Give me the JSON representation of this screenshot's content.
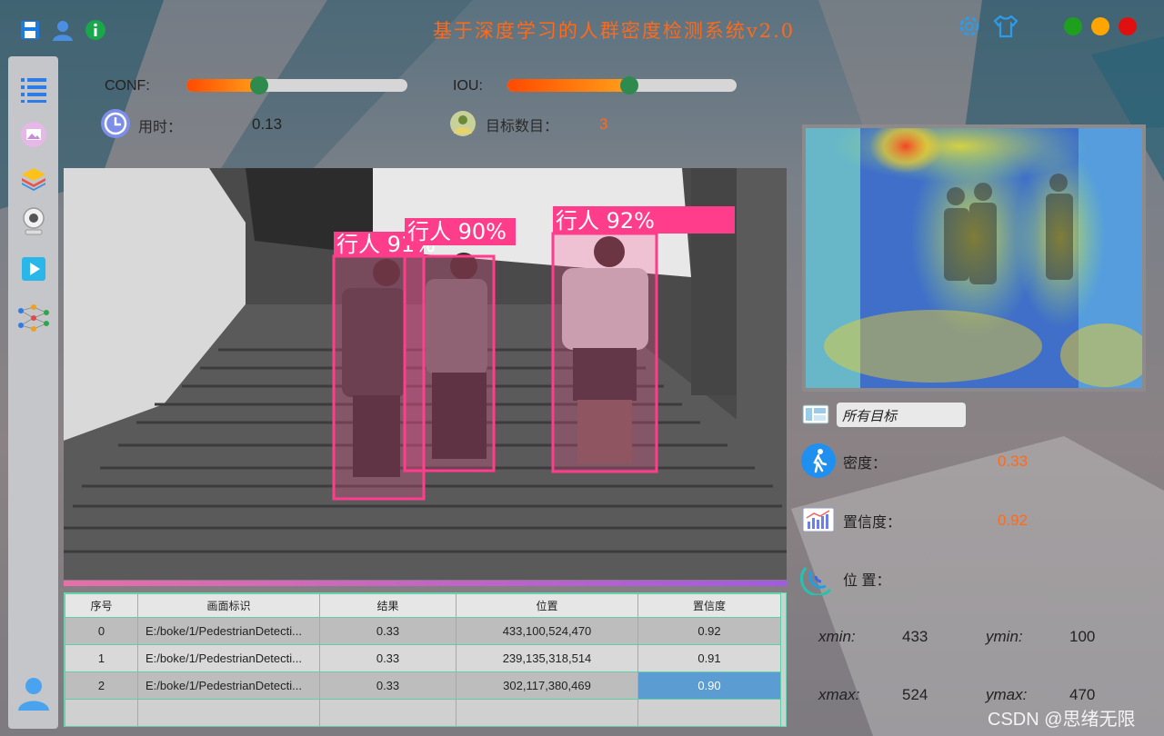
{
  "app": {
    "title": "基于深度学习的人群密度检测系统v2.0",
    "accent": "#ff6a1a"
  },
  "toolbar_icons": [
    "save-icon",
    "user-icon",
    "info-icon",
    "settings-icon",
    "theme-shirt-icon"
  ],
  "window_controls": {
    "colors": [
      "#1ea01e",
      "#ffa500",
      "#e01010"
    ]
  },
  "sidebar": {
    "items": [
      "list-icon",
      "image-icon",
      "layers-icon",
      "camera-icon",
      "play-icon",
      "network-icon"
    ],
    "bottom": "avatar-icon"
  },
  "params": {
    "conf_label": "CONF:",
    "conf_value": 0.33,
    "iou_label": "IOU:",
    "iou_value": 0.53
  },
  "stats": {
    "time_label": "用时：",
    "time_value": "0.13",
    "count_label": "目标数目：",
    "count_value": "3"
  },
  "detections": [
    {
      "label": "行人",
      "score": "91%"
    },
    {
      "label": "行人",
      "score": "90%"
    },
    {
      "label": "行人",
      "score": "92%"
    }
  ],
  "table": {
    "headers": [
      "序号",
      "画面标识",
      "结果",
      "位置",
      "置信度"
    ],
    "rows": [
      [
        "0",
        "E:/boke/1/PedestrianDetecti...",
        "0.33",
        "433,100,524,470",
        "0.92"
      ],
      [
        "1",
        "E:/boke/1/PedestrianDetecti...",
        "0.33",
        "239,135,318,514",
        "0.91"
      ],
      [
        "2",
        "E:/boke/1/PedestrianDetecti...",
        "0.33",
        "302,117,380,469",
        "0.90"
      ]
    ]
  },
  "right": {
    "target_select": "所有目标",
    "density_label": "密度：",
    "density_value": "0.33",
    "confidence_label": "置信度：",
    "confidence_value": "0.92",
    "position_label": "位 置：",
    "xmin_label": "xmin:",
    "xmin_value": "433",
    "ymin_label": "ymin:",
    "ymin_value": "100",
    "xmax_label": "xmax:",
    "xmax_value": "524",
    "ymax_label": "ymax:",
    "ymax_value": "470"
  },
  "watermark": "CSDN @思绪无限"
}
